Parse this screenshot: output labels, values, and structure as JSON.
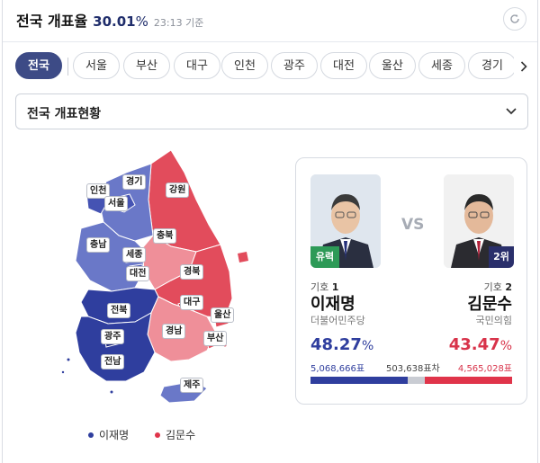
{
  "header": {
    "title": "전국 개표율",
    "percent": "30.01",
    "percent_unit": "%",
    "time": "23:13 기준"
  },
  "tabs": [
    {
      "label": "전국",
      "active": true
    },
    {
      "label": "서울"
    },
    {
      "label": "부산"
    },
    {
      "label": "대구"
    },
    {
      "label": "인천"
    },
    {
      "label": "광주"
    },
    {
      "label": "대전"
    },
    {
      "label": "울산"
    },
    {
      "label": "세종"
    },
    {
      "label": "경기"
    }
  ],
  "select": {
    "value": "전국 개표현황"
  },
  "map": {
    "regions": {
      "incheon": "인천",
      "gyeonggi": "경기",
      "seoul": "서울",
      "gangwon": "강원",
      "chungnam": "충남",
      "chungbuk": "충북",
      "sejong": "세종",
      "daejeon": "대전",
      "gyeongbuk": "경북",
      "daegu": "대구",
      "jeonbuk": "전북",
      "ulsan": "울산",
      "gwangju": "광주",
      "gyeongnam": "경남",
      "busan": "부산",
      "jeonnam": "전남",
      "jeju": "제주"
    },
    "colors": {
      "party_a": "#2f3e9e",
      "party_a_light": "#6a78c8",
      "party_b": "#e24c5c",
      "party_b_light": "#ef8f99"
    }
  },
  "legend": [
    {
      "label": "이재명",
      "color": "#2f3e9e"
    },
    {
      "label": "김문수",
      "color": "#e0344a"
    }
  ],
  "candidates": {
    "vs": "VS",
    "left": {
      "number_prefix": "기호",
      "number": "1",
      "name": "이재명",
      "party": "더불어민주당",
      "rate": "48.27",
      "rate_unit": "%",
      "votes": "5,068,666표",
      "tag": "유력",
      "color": "#2f3e9e"
    },
    "right": {
      "number_prefix": "기호",
      "number": "2",
      "name": "김문수",
      "party": "국민의힘",
      "rate": "43.47",
      "rate_unit": "%",
      "votes": "4,565,028표",
      "tag": "2위",
      "color": "#d8334a"
    },
    "gap": "503,638표차",
    "share": {
      "left": 0.4827,
      "right": 0.4347
    }
  }
}
